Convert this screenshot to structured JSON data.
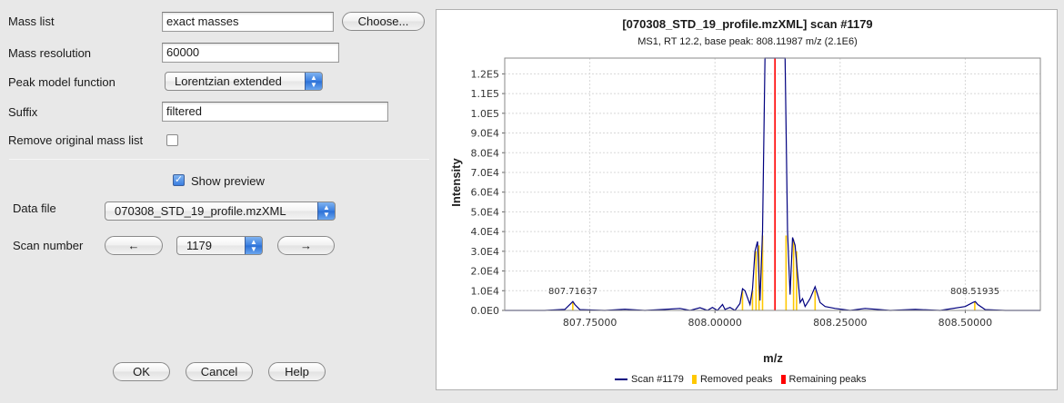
{
  "form": {
    "mass_list": {
      "label": "Mass list",
      "value": "exact masses",
      "choose_label": "Choose..."
    },
    "mass_resolution": {
      "label": "Mass resolution",
      "value": "60000"
    },
    "peak_model": {
      "label": "Peak model function",
      "value": "Lorentzian extended"
    },
    "suffix": {
      "label": "Suffix",
      "value": "filtered"
    },
    "remove_original": {
      "label": "Remove original mass list",
      "checked": false
    },
    "show_preview": {
      "label": "Show preview",
      "checked": true
    },
    "data_file": {
      "label": "Data file",
      "value": "070308_STD_19_profile.mzXML"
    },
    "scan_number": {
      "label": "Scan number",
      "value": "1179",
      "prev_label": "←",
      "next_label": "→"
    }
  },
  "buttons": {
    "ok": "OK",
    "cancel": "Cancel",
    "help": "Help"
  },
  "icons": {
    "combo_arrows": "up-down-arrows-icon",
    "checkbox_check": "check-icon"
  },
  "colors": {
    "scan_line": "#00007f",
    "removed_peaks": "#ffc800",
    "remaining_peaks": "#ff0000",
    "selection_blue": "#3a7ee0"
  },
  "chart_data": {
    "type": "line",
    "title": "[070308_STD_19_profile.mzXML] scan #1179",
    "subtitle": "MS1, RT 12.2, base peak: 808.11987 m/z (2.1E6)",
    "xlabel": "m/z",
    "ylabel": "Intensity",
    "xlim": [
      807.58,
      808.65
    ],
    "ylim": [
      0,
      128000
    ],
    "x_ticks": [
      807.75,
      808.0,
      808.25,
      808.5
    ],
    "x_tick_labels": [
      "807.75000",
      "808.00000",
      "808.25000",
      "808.50000"
    ],
    "y_ticks": [
      0,
      10000,
      20000,
      30000,
      40000,
      50000,
      60000,
      70000,
      80000,
      90000,
      100000,
      110000,
      120000
    ],
    "y_tick_labels": [
      "0.0E0",
      "1.0E4",
      "2.0E4",
      "3.0E4",
      "4.0E4",
      "5.0E4",
      "6.0E4",
      "7.0E4",
      "8.0E4",
      "9.0E4",
      "1.0E5",
      "1.1E5",
      "1.2E5"
    ],
    "grid": true,
    "legend_position": "bottom",
    "annotations": [
      {
        "x": 807.71637,
        "y": 4500,
        "text": "807.71637"
      },
      {
        "x": 808.51935,
        "y": 4500,
        "text": "808.51935"
      }
    ],
    "series": [
      {
        "name": "Scan #1179",
        "kind": "line",
        "x": [
          807.58,
          807.66,
          807.7,
          807.712,
          807.716,
          807.72,
          807.73,
          807.78,
          807.82,
          807.86,
          807.9,
          807.93,
          807.95,
          807.97,
          807.985,
          807.995,
          808.005,
          808.015,
          808.02,
          808.03,
          808.04,
          808.05,
          808.055,
          808.06,
          808.07,
          808.075,
          808.08,
          808.085,
          808.09,
          808.095,
          808.1,
          808.105,
          808.11,
          808.135,
          808.14,
          808.145,
          808.15,
          808.155,
          808.16,
          808.17,
          808.175,
          808.18,
          808.19,
          808.2,
          808.21,
          808.22,
          808.24,
          808.27,
          808.3,
          808.35,
          808.4,
          808.45,
          808.5,
          808.515,
          808.52,
          808.525,
          808.54,
          808.58,
          808.65
        ],
        "y": [
          0,
          0,
          500,
          3500,
          4500,
          3000,
          400,
          0,
          600,
          0,
          500,
          1000,
          0,
          1400,
          0,
          1500,
          0,
          3000,
          500,
          1500,
          0,
          3500,
          11000,
          10000,
          3000,
          11000,
          30000,
          35000,
          5000,
          40000,
          2100000,
          2100000,
          2100000,
          2100000,
          2100000,
          40000,
          8000,
          37000,
          33000,
          4000,
          6000,
          2000,
          6000,
          12000,
          4000,
          2000,
          1000,
          0,
          1000,
          0,
          500,
          0,
          2000,
          4000,
          4500,
          3000,
          400,
          0,
          0
        ]
      },
      {
        "name": "Removed peaks",
        "kind": "sticks",
        "x": [
          807.716,
          808.055,
          808.075,
          808.082,
          808.088,
          808.095,
          808.142,
          808.157,
          808.163,
          808.2,
          808.519
        ],
        "y": [
          4500,
          10000,
          10000,
          30000,
          33000,
          38000,
          38000,
          36000,
          30000,
          10000,
          4500
        ]
      },
      {
        "name": "Remaining peaks",
        "kind": "sticks",
        "x": [
          808.11987
        ],
        "y": [
          2100000
        ]
      }
    ]
  }
}
